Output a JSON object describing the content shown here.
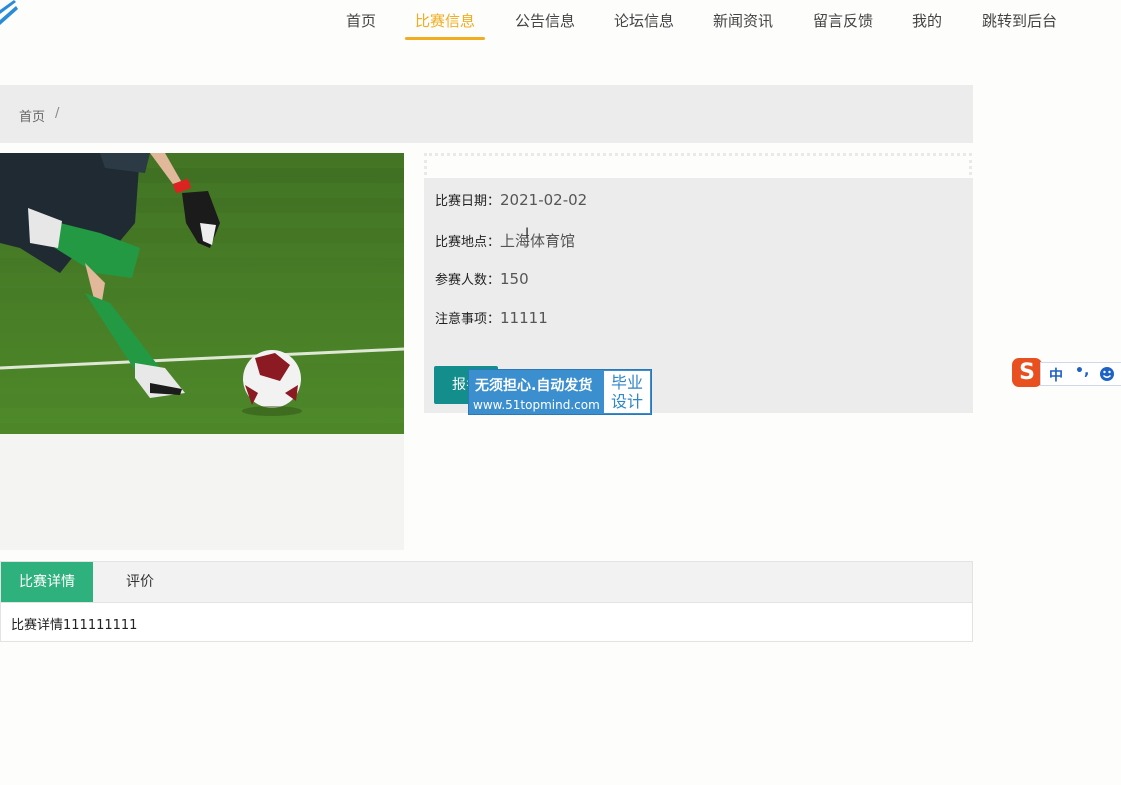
{
  "nav": {
    "items": [
      {
        "label": "首页",
        "active": false
      },
      {
        "label": "比赛信息",
        "active": true
      },
      {
        "label": "公告信息",
        "active": false
      },
      {
        "label": "论坛信息",
        "active": false
      },
      {
        "label": "新闻资讯",
        "active": false
      },
      {
        "label": "留言反馈",
        "active": false
      },
      {
        "label": "我的",
        "active": false
      },
      {
        "label": "跳转到后台",
        "active": false
      }
    ],
    "accent_color": "#f0ad1f"
  },
  "breadcrumb": {
    "home": "首页",
    "separator": "/"
  },
  "detail": {
    "date_label": "比赛日期：",
    "date_value": "2021-02-02",
    "location_label": "比赛地点：",
    "location_value": "上海体育馆",
    "participants_label": "参赛人数：",
    "participants_value": "150",
    "notes_label": "注意事项：",
    "notes_value": "11111",
    "signup_label": "报名"
  },
  "watermark": {
    "line1": "无须担心.自动发货",
    "line2": "www.51topmind.com",
    "box_line1": "毕业",
    "box_line2": "设计"
  },
  "ime": {
    "logo": "S",
    "mode": "中",
    "punct": "•,",
    "icon": "smiley-icon"
  },
  "tabs": {
    "items": [
      {
        "label": "比赛详情",
        "active": true
      },
      {
        "label": "评价",
        "active": false
      }
    ],
    "content": "比赛详情111111111",
    "active_color": "#2fb17e"
  }
}
